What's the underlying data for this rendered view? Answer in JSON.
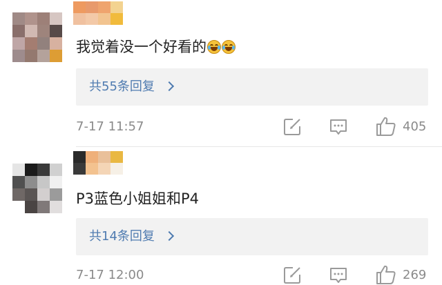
{
  "comments": [
    {
      "text": "我觉着没一个好看的",
      "emoji": [
        "laugh-cry-emoji",
        "laugh-cry-emoji"
      ],
      "reply_label": "共55条回复",
      "time": "7-17 11:57",
      "likes": "405",
      "avatar_colors": [
        "#a08a86",
        "#b0938c",
        "#9d8078",
        "#d6c6c2",
        "#8a6f6b",
        "#d1b9b2",
        "#9e847c",
        "#574a48",
        "#bfa6a6",
        "#a47d71",
        "#92817d",
        "#d7b1a0",
        "#9e8c8d",
        "#94796f",
        "#b4a29b",
        "#dd9d34"
      ],
      "name_colors": [
        "#ee9a60",
        "#f0c1a0",
        "#e89a6c",
        "#f3c9a8",
        "#efa46e",
        "#f2c490",
        "#f3d390",
        "#f1bb3c"
      ]
    },
    {
      "text": "P3蓝色小姐姐和P4",
      "emoji": [],
      "reply_label": "共14条回复",
      "time": "7-17 12:00",
      "likes": "269",
      "avatar_colors": [
        "#e5e5e5",
        "#1b1b1b",
        "#3a3a3a",
        "#d0d0d0",
        "#505050",
        "#8d8d8d",
        "#c7c7c7",
        "#f0f0f0",
        "#6f6866",
        "#5a5554",
        "#d3cfcf",
        "#9b9b9b",
        "#ffffff",
        "#4a4443",
        "#807979",
        "#e1dede"
      ],
      "name_colors": [
        "#2a2a2a",
        "#3a3a3a",
        "#efb07a",
        "#f3c28f",
        "#e9c09a",
        "#f4d5b6",
        "#e9b842",
        "#f6f0e6"
      ]
    }
  ],
  "colors": {
    "link": "#4f7bb0",
    "muted": "#8a8a8a",
    "reply_bg": "#f2f2f2"
  },
  "icons": {
    "share": "share-edit-icon",
    "comment": "comment-icon",
    "like": "thumbs-up-icon"
  }
}
